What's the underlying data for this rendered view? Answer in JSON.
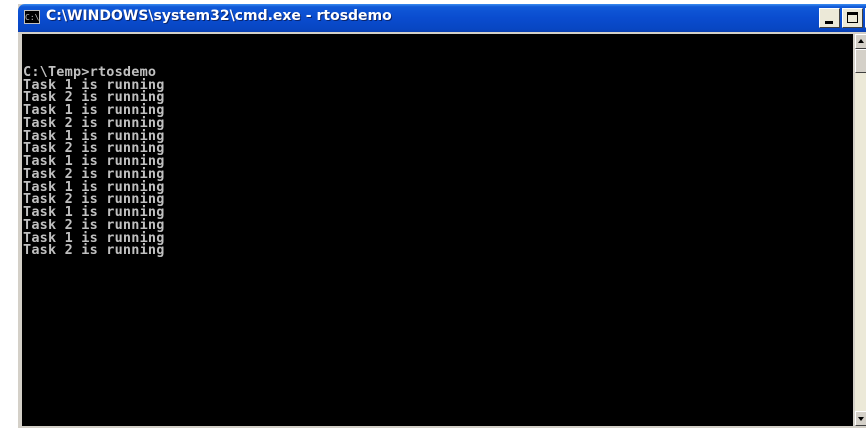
{
  "window": {
    "title": "C:\\WINDOWS\\system32\\cmd.exe - rtosdemo",
    "icon_text": "C:\\",
    "icon": "console-icon",
    "controls": [
      "minimize-icon",
      "maximize-icon",
      "close-icon"
    ],
    "close_glyph": "×"
  },
  "colors": {
    "titlebar": "#0a4ccf",
    "console_background": "#000000",
    "console_text": "#c0c0c0"
  },
  "console": {
    "lines": [
      "",
      "C:\\Temp>rtosdemo",
      "Task 1 is running",
      "Task 2 is running",
      "Task 1 is running",
      "Task 2 is running",
      "Task 1 is running",
      "Task 2 is running",
      "Task 1 is running",
      "Task 2 is running",
      "Task 1 is running",
      "Task 2 is running",
      "Task 1 is running",
      "Task 2 is running",
      "Task 1 is running",
      "Task 2 is running"
    ]
  }
}
